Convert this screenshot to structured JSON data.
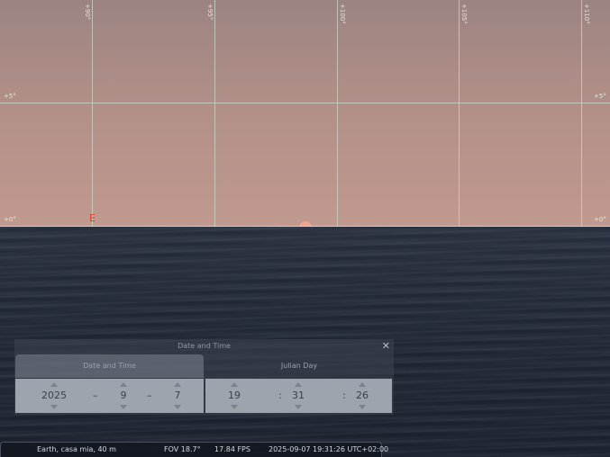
{
  "sky": {
    "meridians": [
      "+90°",
      "+95°",
      "+100°",
      "+105°",
      "+110°"
    ],
    "parallels": {
      "upper_left": "+5°",
      "upper_right": "+5°",
      "lower_left": "+0°",
      "lower_right": "+0°"
    },
    "cardinal": "E",
    "colors": {
      "sky_top": "#9c8481",
      "sky_bottom": "#c0998f",
      "grid": "#c9d7c6",
      "cardinal": "#d6452e",
      "sun": "#f0a48e"
    }
  },
  "dialog": {
    "title": "Date and Time",
    "close_glyph": "✕",
    "tabs": [
      {
        "label": "Date and Time",
        "active": true
      },
      {
        "label": "Julian Day",
        "active": false
      }
    ],
    "date": {
      "year": "2025",
      "month": "9",
      "day": "7",
      "separator": "–"
    },
    "time": {
      "hour": "19",
      "minute": "31",
      "second": "26",
      "separator": ":"
    }
  },
  "statusbar": {
    "location": "Earth, casa mia, 40 m",
    "fov": "FOV 18.7°",
    "fps": "17.84 FPS",
    "datetime": "2025-09-07 19:31:26 UTC+02:00"
  }
}
